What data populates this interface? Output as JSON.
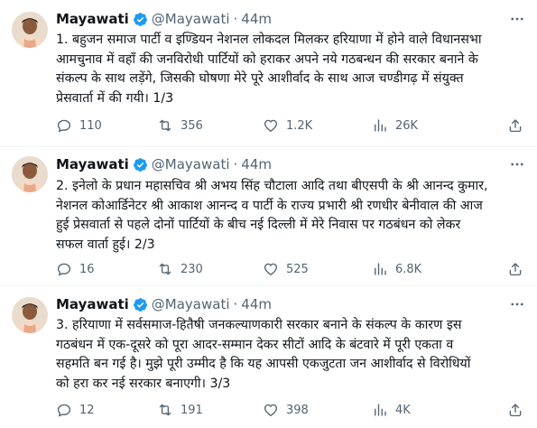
{
  "tweets": [
    {
      "name": "Mayawati",
      "handle": "@Mayawati",
      "separator": "·",
      "time": "44m",
      "lines": [
        "1. बहुजन समाज पार्टी व इण्डियन नेशनल लोकदल मिलकर हरियाणा में होने वाले विधानसभा",
        "आमचुनाव में वहाँ की जनविरोधी पार्टियों को हराकर अपने नये गठबन्धन की सरकार बनाने के",
        "संकल्प के साथ लड़ेंगे, जिसकी घोषणा मेरे पूरे आशीर्वाद के साथ आज चण्डीगढ़ में संयुक्त",
        "प्रेसवार्ता में की गयी। 1/3"
      ],
      "replies": "110",
      "retweets": "356",
      "likes": "1.2K",
      "views": "26K"
    },
    {
      "name": "Mayawati",
      "handle": "@Mayawati",
      "separator": "·",
      "time": "44m",
      "lines": [
        "2. इनेलो के प्रधान महासचिव श्री अभय सिंह चौटाला आदि तथा बीएसपी के श्री आनन्द कुमार,",
        "नेशनल कोआर्डिनेटर श्री आकाश आनन्द व पार्टी के राज्य प्रभारी श्री रणधीर बेनीवाल की आज",
        "हुई प्रेसवार्ता से पहले दोनों पार्टियों के बीच नई दिल्ली में मेरे निवास पर गठबंधन को लेकर",
        "सफल वार्ता हुई। 2/3"
      ],
      "replies": "16",
      "retweets": "230",
      "likes": "525",
      "views": "6.8K"
    },
    {
      "name": "Mayawati",
      "handle": "@Mayawati",
      "separator": "·",
      "time": "44m",
      "lines": [
        "3. हरियाणा में सर्वसमाज-हितैषी जनकल्याणकारी सरकार बनाने के संकल्प के कारण इस",
        "गठबंधन में एक-दूसरे को पूरा आदर-सम्मान देकर सीटों आदि के बंटवारे में पूरी एकता व",
        "सहमति बन गई है। मुझे पूरी उम्मीद है कि यह आपसी एकजुटता जन आशीर्वाद से विरोधियों",
        "को हरा कर नई सरकार बनाएगी। 3/3"
      ],
      "replies": "12",
      "retweets": "191",
      "likes": "398",
      "views": "4K"
    }
  ],
  "colors": {
    "text": "#0f1419",
    "muted": "#536471",
    "verified": "#1d9bf0",
    "divider": "#eff3f4"
  },
  "icons": [
    "verified-badge-icon",
    "more-icon",
    "reply-icon",
    "retweet-icon",
    "like-icon",
    "views-icon"
  ]
}
